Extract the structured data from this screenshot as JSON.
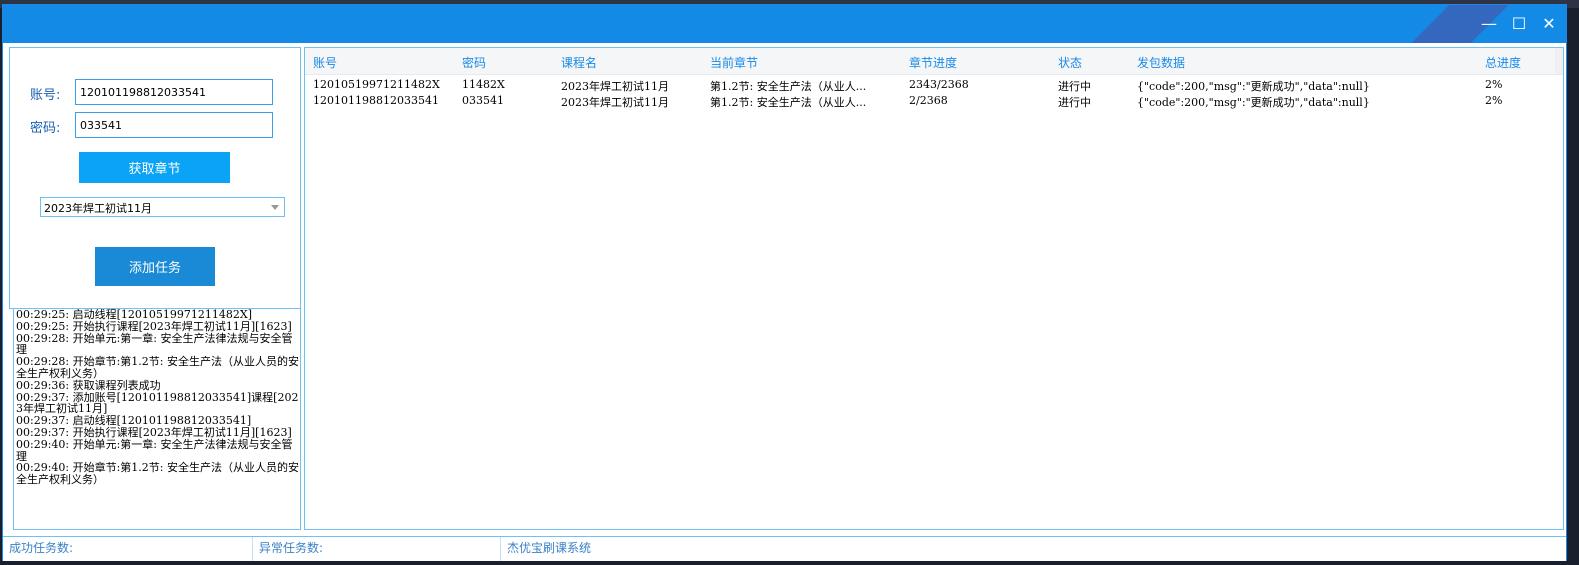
{
  "window": {
    "controls": {
      "minimize": "—",
      "maximize": "☐",
      "close": "✕"
    }
  },
  "form": {
    "account_label": "账号:",
    "account_value": "120101198812033541",
    "password_label": "密码:",
    "password_value": "033541",
    "fetch_button": "获取章节",
    "course_selected": "2023年焊工初试11月",
    "add_task_button": "添加任务"
  },
  "log": [
    "00:29:25: 启动线程[12010519971211482X]",
    "00:29:25: 开始执行课程[2023年焊工初试11月][1623]",
    "00:29:28: 开始单元:第一章: 安全生产法律法规与安全管理",
    "00:29:28: 开始章节:第1.2节: 安全生产法（从业人员的安全生产权利义务）",
    "00:29:36: 获取课程列表成功",
    "00:29:37: 添加账号[120101198812033541]课程[2023年焊工初试11月]",
    "00:29:37: 启动线程[120101198812033541]",
    "00:29:37: 开始执行课程[2023年焊工初试11月][1623]",
    "00:29:40: 开始单元:第一章: 安全生产法律法规与安全管理",
    "00:29:40: 开始章节:第1.2节: 安全生产法（从业人员的安全生产权利义务）"
  ],
  "table": {
    "headers": [
      "账号",
      "密码",
      "课程名",
      "当前章节",
      "章节进度",
      "状态",
      "发包数据",
      "总进度"
    ],
    "rows": [
      [
        "12010519971211482X",
        "11482X",
        "2023年焊工初试11月",
        "第1.2节: 安全生产法（从业人...",
        "2343/2368",
        "进行中",
        "{\"code\":200,\"msg\":\"更新成功\",\"data\":null}",
        "2%"
      ],
      [
        "120101198812033541",
        "033541",
        "2023年焊工初试11月",
        "第1.2节: 安全生产法（从业人...",
        "2/2368",
        "进行中",
        "{\"code\":200,\"msg\":\"更新成功\",\"data\":null}",
        "2%"
      ]
    ]
  },
  "status": {
    "success_label": "成功任务数:",
    "error_label": "异常任务数:",
    "app_name": "杰优宝刷课系统"
  },
  "colors": {
    "title_bar": "#138be6",
    "button_primary": "#0aa3f5",
    "button_secondary": "#1a8ad6",
    "accent": "#1a8ae6"
  }
}
